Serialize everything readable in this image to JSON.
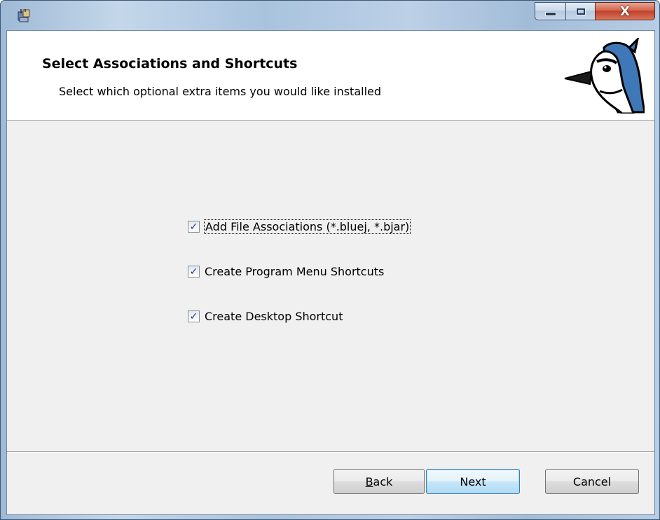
{
  "window": {
    "icon": "installer-icon",
    "controls": {
      "minimize": "minimize-icon",
      "maximize": "maximize-icon",
      "close_glyph": "X"
    }
  },
  "banner": {
    "title": "Select Associations and Shortcuts",
    "subtitle": "Select which optional extra items you would like installed",
    "logo": "bluej-bird-logo"
  },
  "options": [
    {
      "label": "Add File Associations (*.bluej, *.bjar)",
      "checked": true,
      "focused": true
    },
    {
      "label": "Create Program Menu Shortcuts",
      "checked": true,
      "focused": false
    },
    {
      "label": "Create Desktop Shortcut",
      "checked": true,
      "focused": false
    }
  ],
  "buttons": {
    "back_mnemonic": "B",
    "back_rest": "ack",
    "next": "Next",
    "cancel": "Cancel"
  },
  "check_glyph": "✓",
  "colors": {
    "frame": "#a9c3de",
    "client_bg": "#f0f0f0",
    "close_button": "#c1412b",
    "default_button_border": "#3c7fb1"
  }
}
